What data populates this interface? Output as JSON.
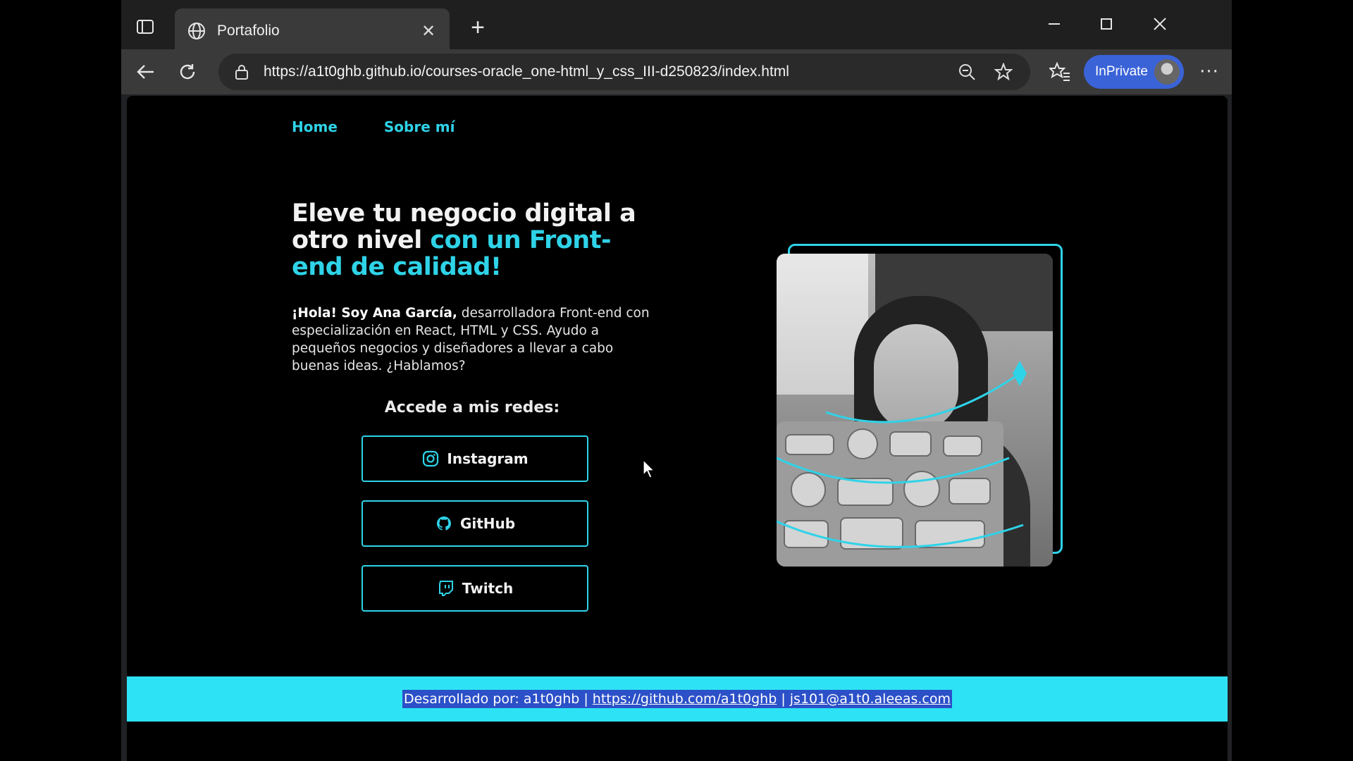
{
  "browser": {
    "tab_title": "Portafolio",
    "url": "https://a1t0ghb.github.io/courses-oracle_one-html_y_css_III-d250823/index.html",
    "profile_label": "InPrivate"
  },
  "nav": {
    "items": [
      {
        "label": "Home"
      },
      {
        "label": "Sobre mí"
      }
    ]
  },
  "hero": {
    "title_part1": "Eleve tu negocio digital a otro nivel ",
    "title_accent": "con un Front-end de calidad!",
    "intro_bold": "¡Hola! Soy Ana García,",
    "intro_text": " desarrolladora Front-end con especialización en React, HTML y CSS. Ayudo a pequeños negocios y diseñadores a llevar a cabo buenas ideas. ¿Hablamos?"
  },
  "social": {
    "heading": "Accede a mis redes:",
    "buttons": [
      {
        "label": "Instagram",
        "icon": "instagram-icon"
      },
      {
        "label": "GitHub",
        "icon": "github-icon"
      },
      {
        "label": "Twitch",
        "icon": "twitch-icon"
      }
    ]
  },
  "footer": {
    "prefix": "Desarrollado por: a1t0ghb | ",
    "link1": "https://github.com/a1t0ghb",
    "separator": " | ",
    "link2": "js101@a1t0.aleeas.com"
  },
  "colors": {
    "accent": "#2fd3e8",
    "footer_bg": "#2ee2f5",
    "selection": "#2b50c8",
    "inprivate": "#3a63d8"
  }
}
